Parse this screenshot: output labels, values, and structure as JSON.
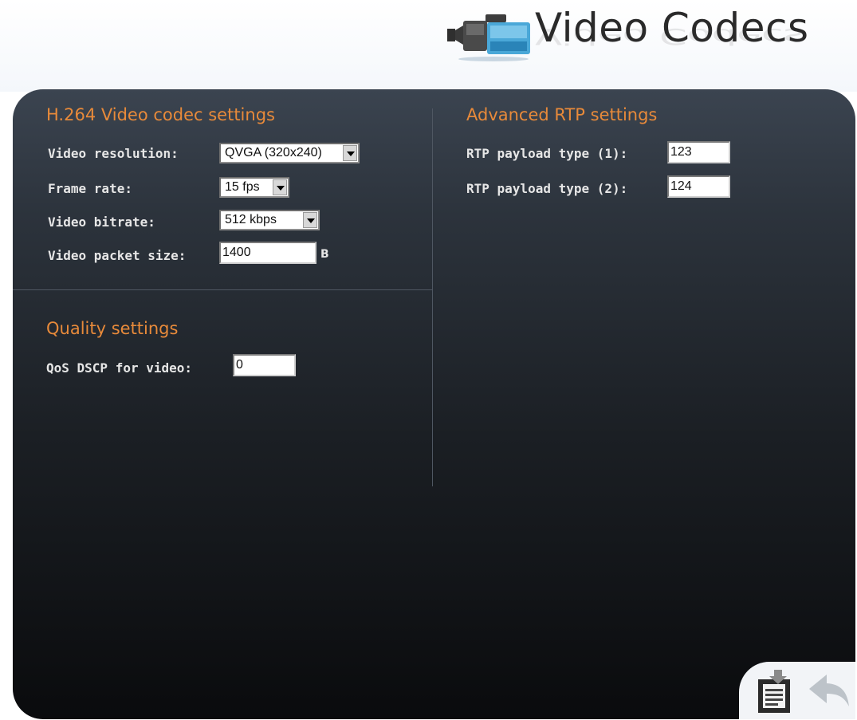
{
  "header": {
    "title": "Video Codecs",
    "icon": "video-camera-icon"
  },
  "sections": {
    "h264": {
      "title": "H.264 Video codec settings",
      "fields": {
        "resolution": {
          "label": "Video resolution:",
          "value": "QVGA (320x240)"
        },
        "frame_rate": {
          "label": "Frame rate:",
          "value": "15 fps"
        },
        "bitrate": {
          "label": "Video bitrate:",
          "value": "512 kbps"
        },
        "packet_size": {
          "label": "Video packet size:",
          "value": "1400",
          "unit": "B"
        }
      }
    },
    "quality": {
      "title": "Quality settings",
      "fields": {
        "qos_dscp": {
          "label": "QoS DSCP for video:",
          "value": "0"
        }
      }
    },
    "rtp": {
      "title": "Advanced RTP settings",
      "fields": {
        "payload1": {
          "label": "RTP payload type (1):",
          "value": "123"
        },
        "payload2": {
          "label": "RTP payload type (2):",
          "value": "124"
        }
      }
    }
  },
  "actions": {
    "save_icon": "save-icon",
    "back_icon": "back-arrow-icon"
  },
  "colors": {
    "section_title": "#e88a3a",
    "label": "#e6e6e6",
    "panel_top": "#3b4450",
    "panel_bottom": "#0a0b0d"
  }
}
